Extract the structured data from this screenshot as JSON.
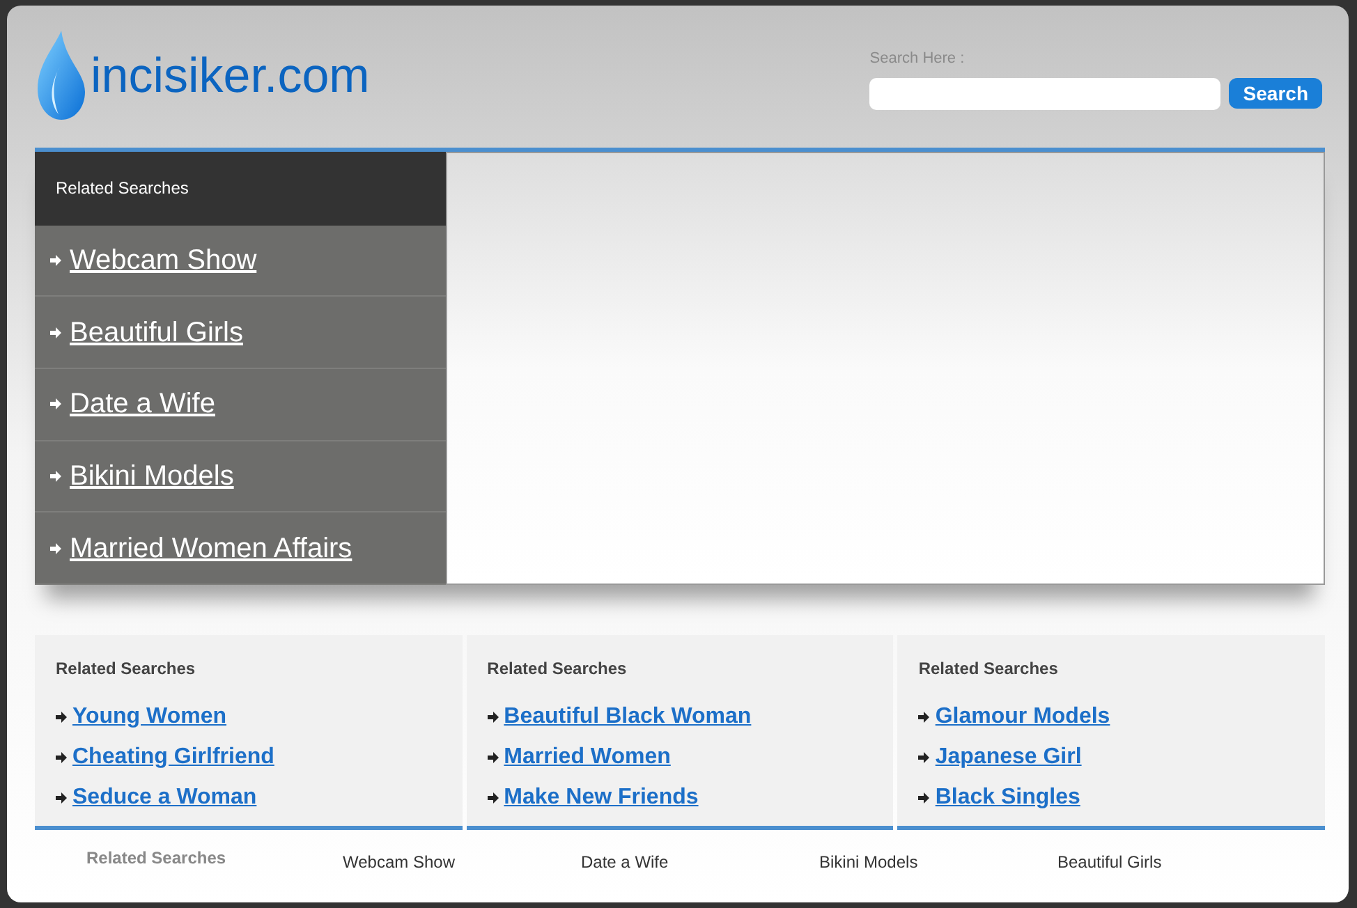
{
  "logo": {
    "text": "incisiker.com"
  },
  "search": {
    "label": "Search Here :",
    "button": "Search"
  },
  "sidebar": {
    "title": "Related Searches",
    "items": [
      {
        "label": "Webcam Show"
      },
      {
        "label": "Beautiful Girls"
      },
      {
        "label": "Date a Wife"
      },
      {
        "label": "Bikini Models"
      },
      {
        "label": "Married Women Affairs"
      }
    ]
  },
  "columns": [
    {
      "title": "Related Searches",
      "links": [
        "Young Women",
        "Cheating Girlfriend",
        "Seduce a Woman"
      ]
    },
    {
      "title": "Related Searches",
      "links": [
        "Beautiful Black Woman",
        "Married Women",
        "Make New Friends"
      ]
    },
    {
      "title": "Related Searches",
      "links": [
        "Glamour Models",
        "Japanese Girl",
        "Black Singles"
      ]
    }
  ],
  "footer": {
    "title": "Related Searches",
    "links": [
      "Webcam Show",
      "Date a Wife",
      "Bikini Models",
      "Beautiful Girls"
    ]
  }
}
